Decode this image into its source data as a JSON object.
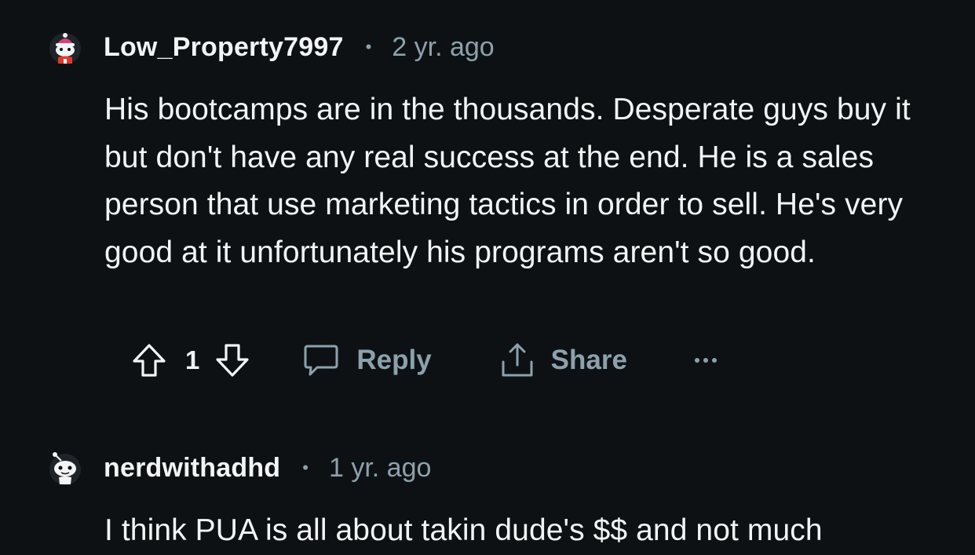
{
  "comments": [
    {
      "username": "Low_Property7997",
      "separator": "•",
      "time": "2 yr. ago",
      "text": "His bootcamps are in the thousands. Desperate guys buy it but don't have any real success at the end. He is a sales person that use marketing tactics in order to sell. He's very good at it unfortunately his programs aren't so good.",
      "avatar_icon": "snoo-avatar-santa-hat",
      "votes": "1",
      "reply_label": "Reply",
      "share_label": "Share",
      "more_icon": "more-options-icon"
    },
    {
      "username": "nerdwithadhd",
      "separator": "•",
      "time": "1 yr. ago",
      "text": "I think PUA is all about takin dude's $$ and not much",
      "avatar_icon": "snoo-avatar-default"
    }
  ],
  "colors": {
    "background": "#0e1113",
    "text_primary": "#f2f4f5",
    "text_secondary": "#8ba2ad",
    "avatar_hat": "#d1447a",
    "avatar_shirt": "#e03a2f"
  }
}
